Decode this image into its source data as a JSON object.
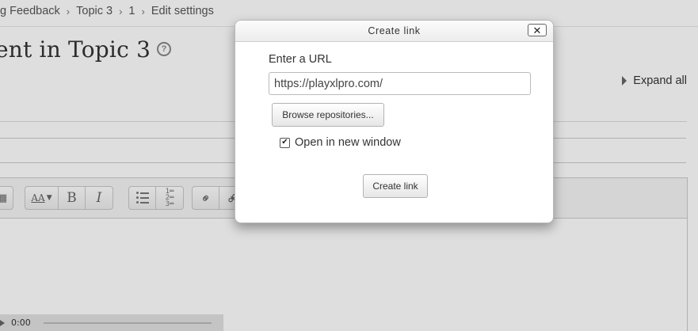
{
  "breadcrumb": {
    "items": [
      "g Feedback",
      "Topic 3",
      "1",
      "Edit settings"
    ],
    "separator": "›"
  },
  "page": {
    "title": "ent in Topic 3",
    "help_icon": "help-icon",
    "expand_all": "Expand all"
  },
  "editor": {
    "toolbar": {
      "font_label": "AA",
      "bold": "B",
      "italic": "I"
    },
    "player": {
      "time": "0:00"
    }
  },
  "dialog": {
    "title": "Create link",
    "close_label": "✕",
    "url_label": "Enter a URL",
    "url_value": "https://playxlpro.com/",
    "browse_button": "Browse repositories...",
    "open_new_window_label": "Open in new window",
    "open_new_window_checked": true,
    "create_button": "Create link"
  }
}
